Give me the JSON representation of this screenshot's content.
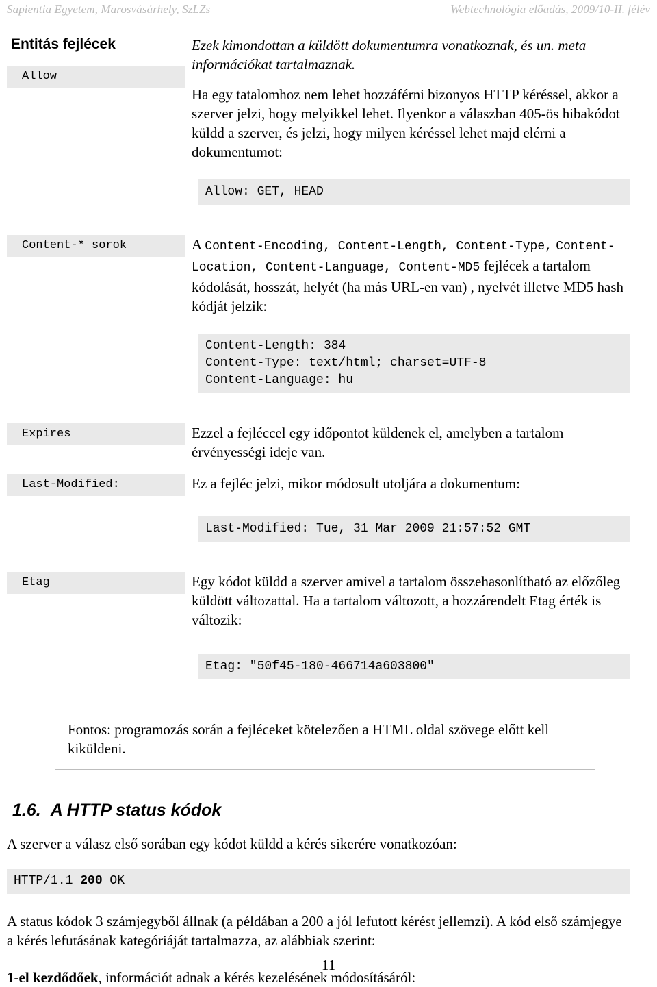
{
  "runhead": {
    "left": "Sapientia Egyetem, Marosvásárhely, SzLZs",
    "right": "Webtechnológia előadás, 2009/10-II. félév"
  },
  "entity_headers": {
    "title": "Entitás fejlécek",
    "intro_italic": "Ezek kimondottan a küldött dokumentumra vonatkoznak, és un. meta információkat tartalmaznak.",
    "allow": {
      "label": "Allow",
      "paragraph": "Ha egy tatalomhoz nem lehet hozzáférni bizonyos HTTP kéréssel, akkor a szerver jelzi, hogy melyikkel lehet. Ilyenkor a válaszban 405-ös hibakódot küldd a szerver, és jelzi, hogy milyen kéréssel lehet majd elérni a dokumentumot:",
      "code": "Allow: GET, HEAD"
    },
    "content_star": {
      "label": "Content-* sorok",
      "lead_a": "A ",
      "headers_line1": "Content-Encoding, Content-Length, Content-Type,",
      "headers_line2": "Content-Location, Content-Language,  Content-MD5",
      "tail_word": " fejlécek",
      "paragraph_rest": "a tartalom kódolását, hosszát, helyét (ha más URL-en van) , nyelvét illetve MD5 hash kódját jelzik:",
      "code": "Content-Length: 384\nContent-Type: text/html; charset=UTF-8\nContent-Language: hu"
    },
    "expires": {
      "label": "Expires",
      "paragraph": "Ezzel a fejléccel egy időpontot küldenek el, amelyben a tartalom érvényességi ideje van."
    },
    "last_modified": {
      "label": "Last-Modified:",
      "paragraph": "Ez a fejléc jelzi, mikor módosult utoljára a dokumentum:",
      "code": "Last-Modified: Tue, 31 Mar 2009 21:57:52 GMT"
    },
    "etag": {
      "label": "Etag",
      "paragraph": "Egy kódot küldd a szerver amivel a tartalom összehasonlítható az előzőleg küldött változattal. Ha a tartalom változott, a hozzárendelt Etag érték is változik:",
      "code": "Etag: \"50f45-180-466714a603800\""
    },
    "callout": "Fontos: programozás során a fejléceket kötelezően a HTML oldal szövege előtt kell kiküldeni."
  },
  "status_codes": {
    "heading_number": "1.6.",
    "heading_text": "A HTTP status kódok",
    "intro": "A szerver a válasz első sorában egy kódot küldd a kérés sikerére vonatkozóan:",
    "code_prefix": "HTTP/1.1 ",
    "code_bold": "200",
    "code_suffix": " OK",
    "explanation": "A status kódok 3 számjegyből állnak (a példában a 200 a jól lefutott kérést jellemzi). A kód első számjegye a kérés lefutásának kategóriáját tartalmazza, az alábbiak szerint:",
    "category_bold": "1-el kezdődőek",
    "category_rest": ", információt adnak a kérés kezelésének módosításáról:"
  },
  "folio": "11",
  "colors": {
    "code_background": "#e9e9e9",
    "runhead_text": "#b9b9b9",
    "callout_border": "#bdbdbd",
    "body_text": "#000000"
  }
}
